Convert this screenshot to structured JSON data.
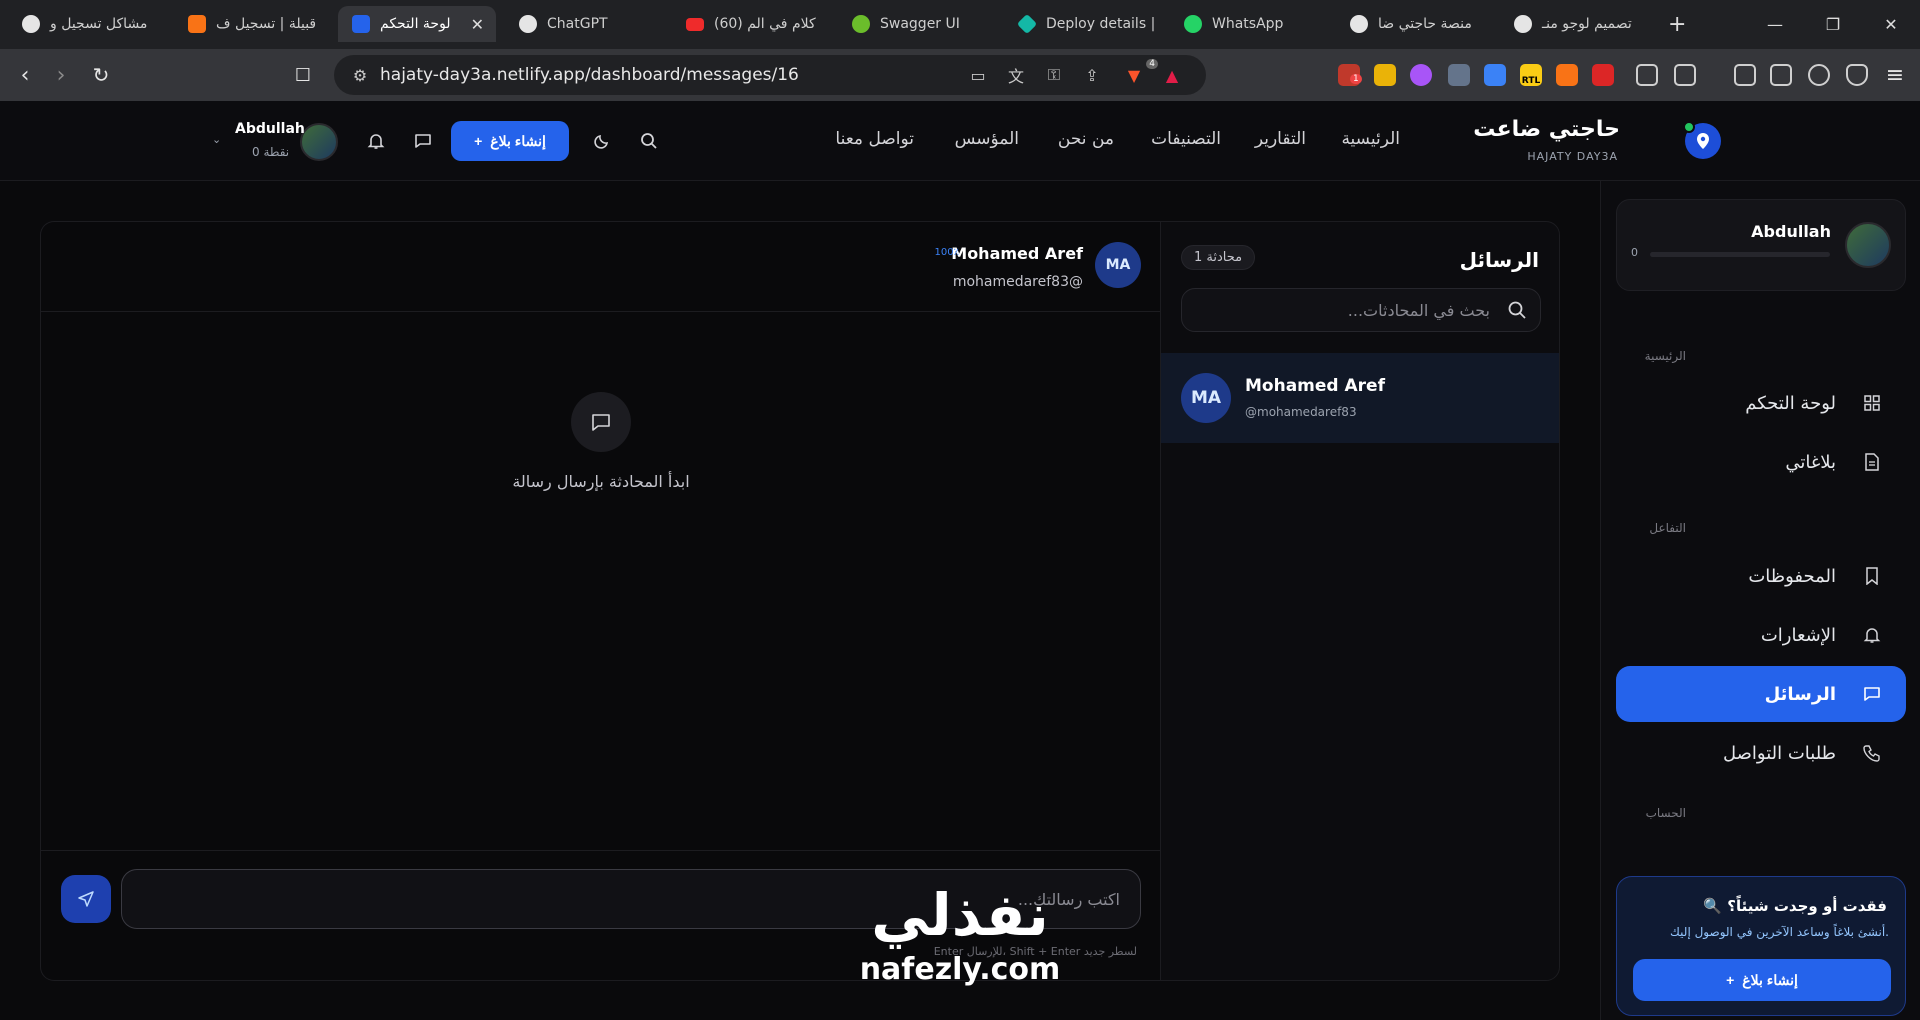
{
  "browser": {
    "tabs": [
      {
        "title": "مشاكل تسجيل و",
        "icon": "chatgpt-icon"
      },
      {
        "title": "قبيلة | تسجيل ف",
        "icon": "orange-icon"
      },
      {
        "title": "لوحة التحكم",
        "icon": "app-pin-icon",
        "active": true
      },
      {
        "title": "ChatGPT",
        "icon": "chatgpt-icon"
      },
      {
        "title": "(60) كلام في الم",
        "icon": "youtube-icon"
      },
      {
        "title": "Swagger UI",
        "icon": "swagger-icon"
      },
      {
        "title": "Deploy details |",
        "icon": "netlify-icon"
      },
      {
        "title": "WhatsApp",
        "icon": "whatsapp-icon"
      },
      {
        "title": "منصة حاجتي ضا",
        "icon": "chatgpt-icon"
      },
      {
        "title": "تصميم لوجو منـ",
        "icon": "chatgpt-icon"
      }
    ],
    "url": "hajaty-day3a.netlify.app/dashboard/messages/16",
    "brave_badge": "4",
    "ext_badge": "1",
    "rtl_label": "RTL"
  },
  "header": {
    "brand_title": "حاجتي ضاعت",
    "brand_subtitle": "HAJATY DAY3A",
    "nav": [
      "الرئيسية",
      "التقارير",
      "التصنيفات",
      "من نحن",
      "المؤسس",
      "تواصل معنا"
    ],
    "create_button": "إنشاء بلاغ",
    "user_name": "Abdullah",
    "user_points": "0 نقطة"
  },
  "sidebar": {
    "profile_name": "Abdullah",
    "profile_points": "0",
    "section_main": "الرئيسية",
    "section_interaction": "التفاعل",
    "section_account": "الحساب",
    "items": [
      {
        "label": "لوحة التحكم",
        "icon": "grid-icon"
      },
      {
        "label": "بلاغاتي",
        "icon": "document-icon"
      },
      {
        "label": "المحفوظات",
        "icon": "bookmark-icon"
      },
      {
        "label": "الإشعارات",
        "icon": "bell-icon"
      },
      {
        "label": "الرسائل",
        "icon": "message-icon",
        "active": true
      },
      {
        "label": "طلبات التواصل",
        "icon": "phone-icon"
      }
    ],
    "promo_title": "🔍 فقدت أو وجدت شيئاً؟",
    "promo_text": "أنشئ بلاغاً وساعد الآخرين في الوصول إليك.",
    "promo_button": "إنشاء بلاغ"
  },
  "conversations": {
    "title": "الرسائل",
    "count": "1 محادثة",
    "search_placeholder": "بحث في المحادثات...",
    "items": [
      {
        "initials": "MA",
        "name": "Mohamed Aref",
        "handle": "@mohamedaref83"
      }
    ]
  },
  "chat": {
    "initials": "MA",
    "name": "Mohamed Aref",
    "match": "100٪",
    "handle": "mohamedaref83@",
    "empty_text": "ابدأ المحادثة بإرسال رسالة",
    "input_placeholder": "اكتب رسالتك...",
    "hint": "Enter للإرسال، Shift + Enter لسطر جديد"
  },
  "watermark": {
    "arabic": "نفذلي",
    "english": "nafezly.com"
  },
  "colors": {
    "accent": "#2563eb",
    "background": "#0a0a0c",
    "online": "#22c55e"
  }
}
